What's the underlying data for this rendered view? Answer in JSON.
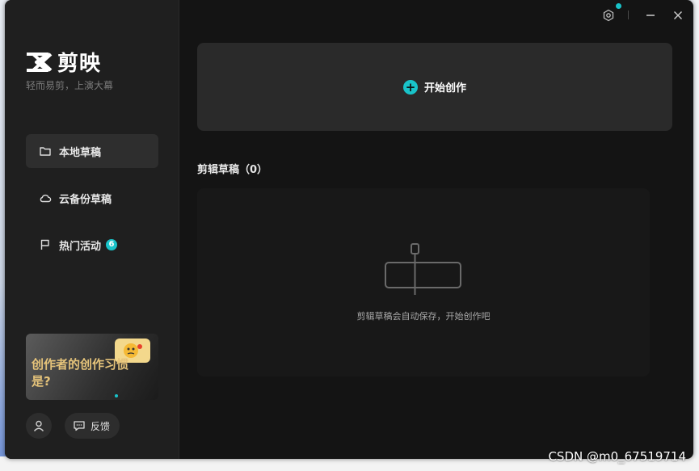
{
  "app": {
    "name": "剪映",
    "tagline": "轻而易剪，上演大幕"
  },
  "sidebar": {
    "items": [
      {
        "label": "本地草稿",
        "icon": "folder-icon",
        "active": true
      },
      {
        "label": "云备份草稿",
        "icon": "cloud-icon",
        "active": false
      },
      {
        "label": "热门活动",
        "icon": "flag-icon",
        "active": false,
        "badge": "6"
      }
    ],
    "banner": {
      "text": "创作者的创作习惯是?"
    },
    "feedback_label": "反馈"
  },
  "titlebar": {
    "icons": [
      "settings-icon",
      "minimize-icon",
      "close-icon"
    ]
  },
  "main": {
    "start_label": "开始创作",
    "drafts_title": "剪辑草稿（0）",
    "empty_text": "剪辑草稿会自动保存，开始创作吧"
  },
  "watermark": "CSDN @m0_67519714",
  "colors": {
    "accent": "#19c3c9",
    "window_bg": "#141414",
    "sidebar_bg": "#1f1f1f",
    "card_bg": "#2a2a2a"
  }
}
